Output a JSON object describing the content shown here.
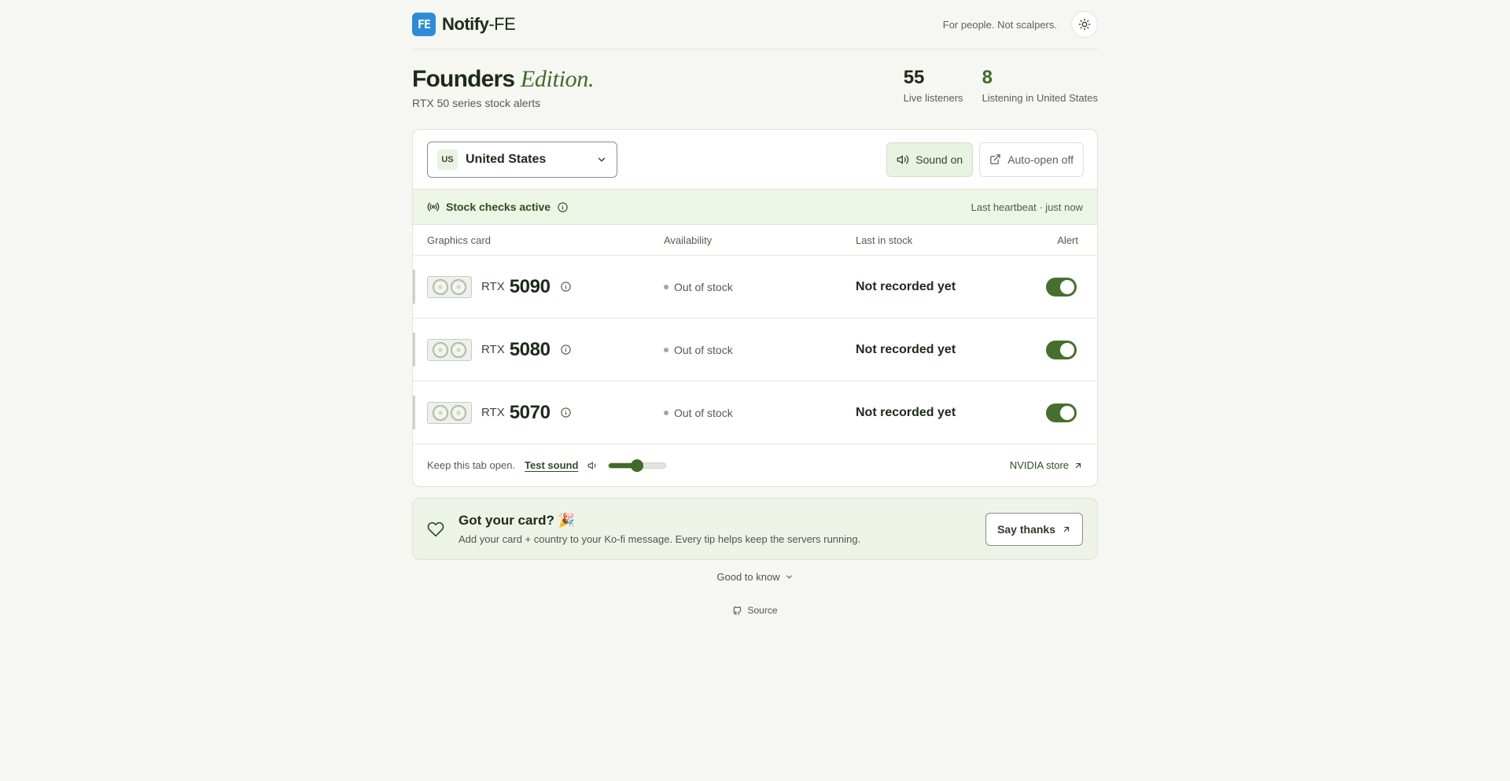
{
  "header": {
    "logo_text": "FE",
    "brand_bold": "Notify",
    "brand_rest": "-FE",
    "tagline": "For people. Not scalpers."
  },
  "hero": {
    "title_bold": "Founders",
    "title_italic": "Edition.",
    "subtitle": "RTX 50 series stock alerts",
    "stats": [
      {
        "value": "55",
        "label": "Live listeners"
      },
      {
        "value": "8",
        "label": "Listening in United States"
      }
    ]
  },
  "controls": {
    "country_code": "US",
    "country_name": "United States",
    "sound_label": "Sound on",
    "autoopen_label": "Auto-open off"
  },
  "status": {
    "label": "Stock checks active",
    "heartbeat": "Last heartbeat · just now"
  },
  "table": {
    "headers": [
      "Graphics card",
      "Availability",
      "Last in stock",
      "Alert"
    ],
    "rows": [
      {
        "prefix": "RTX",
        "model": "5090",
        "availability": "Out of stock",
        "last_in_stock": "Not recorded yet",
        "alert_on": true
      },
      {
        "prefix": "RTX",
        "model": "5080",
        "availability": "Out of stock",
        "last_in_stock": "Not recorded yet",
        "alert_on": true
      },
      {
        "prefix": "RTX",
        "model": "5070",
        "availability": "Out of stock",
        "last_in_stock": "Not recorded yet",
        "alert_on": true
      }
    ]
  },
  "footer": {
    "keep_open": "Keep this tab open.",
    "test_sound": "Test sound",
    "volume": 0.5,
    "store_link": "NVIDIA store"
  },
  "thanks": {
    "title": "Got your card? 🎉",
    "subtitle": "Add your card + country to your Ko-fi message. Every tip helps keep the servers running.",
    "button": "Say thanks"
  },
  "good_to_know": "Good to know",
  "source": "Source",
  "colors": {
    "accent": "#3f6b2a",
    "logo": "#2e8bd8",
    "background": "#f6f6f2"
  }
}
